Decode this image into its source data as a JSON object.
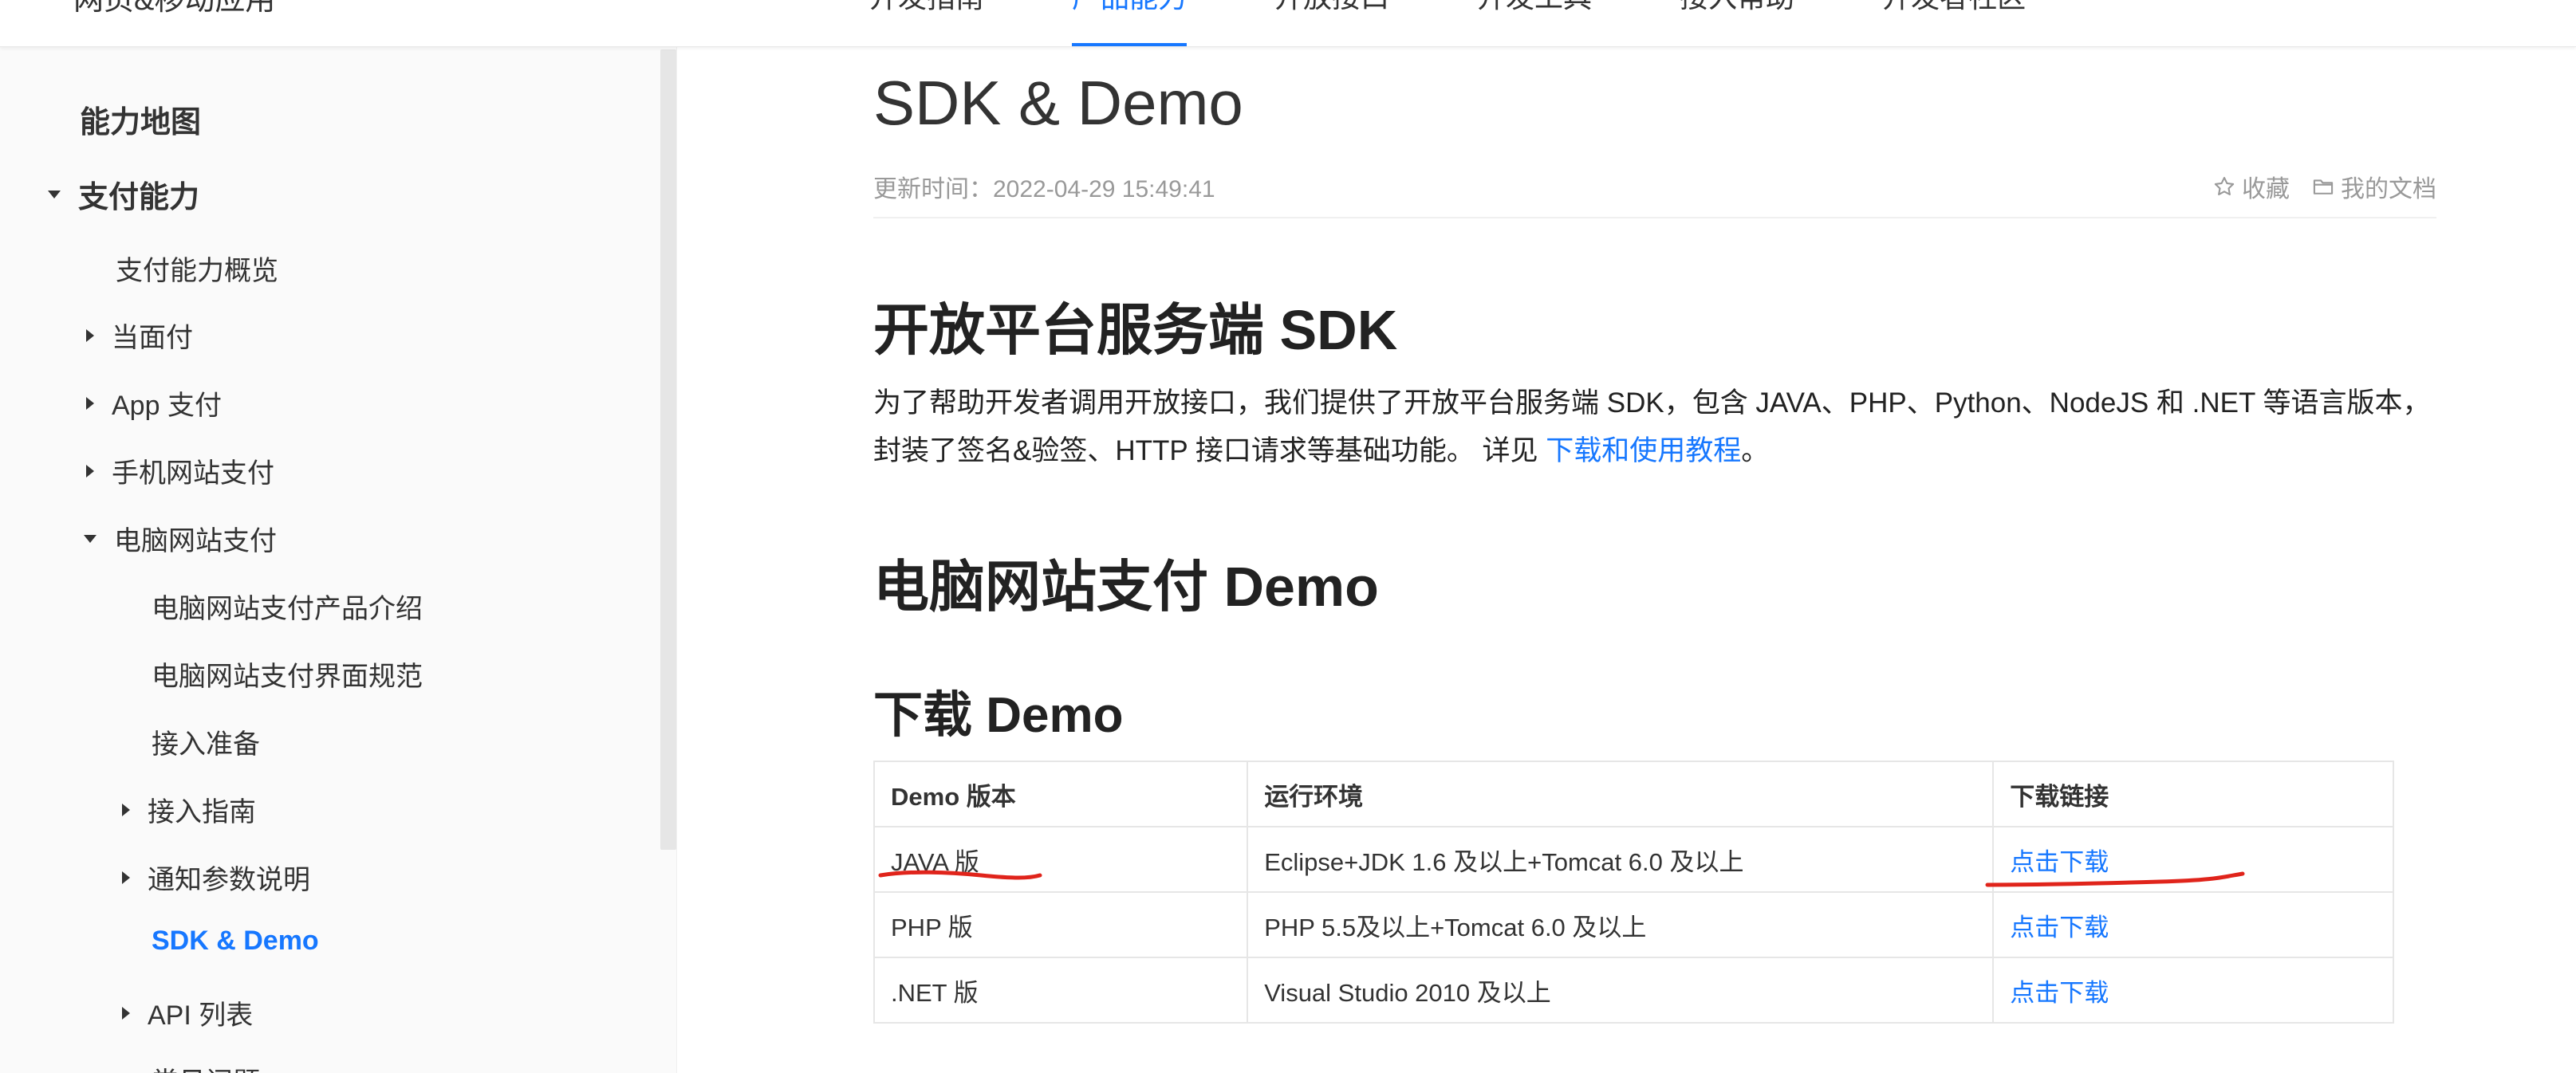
{
  "topbar": {
    "brand": "网页&移动应用",
    "nav": [
      {
        "label": "开发指南",
        "active": false
      },
      {
        "label": "产品能力",
        "active": true
      },
      {
        "label": "开放接口",
        "active": false
      },
      {
        "label": "开发工具",
        "active": false
      },
      {
        "label": "接入帮助",
        "active": false
      },
      {
        "label": "开发者社区",
        "active": false
      }
    ]
  },
  "sidebar": {
    "items": [
      {
        "label": "能力地图"
      },
      {
        "label": "支付能力"
      },
      {
        "label": "支付能力概览"
      },
      {
        "label": "当面付"
      },
      {
        "label": "App 支付"
      },
      {
        "label": "手机网站支付"
      },
      {
        "label": "电脑网站支付"
      },
      {
        "label": "电脑网站支付产品介绍"
      },
      {
        "label": "电脑网站支付界面规范"
      },
      {
        "label": "接入准备"
      },
      {
        "label": "接入指南"
      },
      {
        "label": "通知参数说明"
      },
      {
        "label": "SDK & Demo"
      },
      {
        "label": "API 列表"
      },
      {
        "label": "常见问题"
      }
    ]
  },
  "doc": {
    "title": "SDK & Demo",
    "update_time": "更新时间：2022-04-29 15:49:41",
    "favorite_label": "收藏",
    "my_docs_label": "我的文档"
  },
  "sections": {
    "sdk_heading": "开放平台服务端 SDK",
    "sdk_text": "为了帮助开发者调用开放接口，我们提供了开放平台服务端 SDK，包含 JAVA、PHP、Python、NodeJS 和 .NET 等语言版本，封装了签名&验签、HTTP 接口请求等基础功能。 详见 ",
    "sdk_link": "下载和使用教程",
    "sdk_period": "。",
    "demo_heading": "电脑网站支付 Demo",
    "download_heading": "下载 Demo"
  },
  "table": {
    "headers": [
      "Demo 版本",
      "运行环境",
      "下载链接"
    ],
    "rows": [
      {
        "version": "JAVA 版",
        "env": "Eclipse+JDK 1.6 及以上+Tomcat 6.0 及以上",
        "link": "点击下载"
      },
      {
        "version": "PHP 版",
        "env": "PHP 5.5及以上+Tomcat 6.0 及以上",
        "link": "点击下载"
      },
      {
        "version": ".NET 版",
        "env": "Visual Studio 2010 及以上",
        "link": "点击下载"
      }
    ]
  },
  "colors": {
    "accent": "#1677ff",
    "annotation": "#e0241b",
    "sidebar_bg": "#fafafa"
  }
}
